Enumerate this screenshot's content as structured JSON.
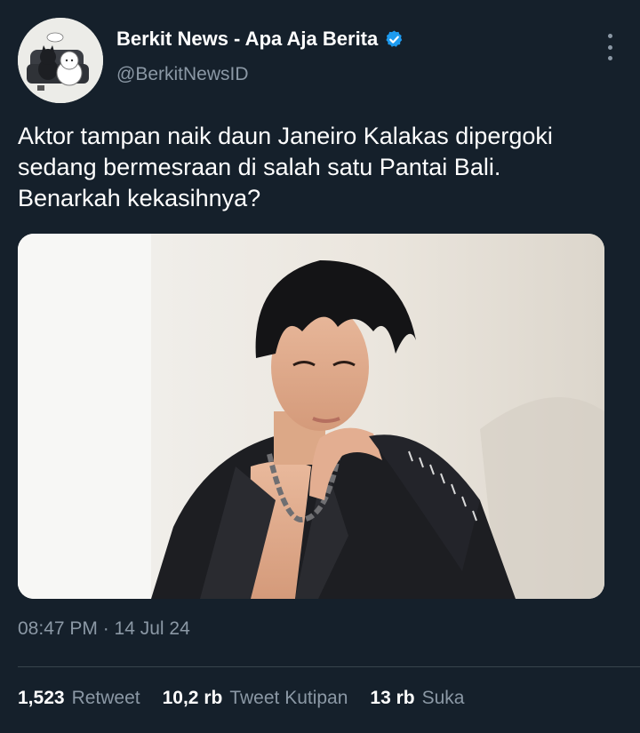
{
  "author": {
    "display_name": "Berkit News - Apa Aja Berita",
    "handle": "@BerkitNewsID",
    "verified": true,
    "avatar_icon": "cartoon-cats-avatar"
  },
  "tweet": {
    "text": "Aktor tampan naik daun Janeiro Kalakas dipergoki\nsedang bermesraan di salah satu Pantai Bali.\nBenarkah kekasihnya?",
    "timestamp": "08:47 PM · 14 Jul 24"
  },
  "stats": {
    "retweets": {
      "count": "1,523",
      "label": "Retweet"
    },
    "quote_tweets": {
      "count": "10,2 rb",
      "label": "Tweet Kutipan"
    },
    "likes": {
      "count": "13 rb",
      "label": "Suka"
    }
  },
  "icons": {
    "verified": "verified-badge-icon",
    "more": "more-options-icon"
  },
  "colors": {
    "background": "#15202b",
    "text_primary": "#ffffff",
    "text_secondary": "#8b98a5",
    "verified": "#1d9bf0",
    "divider": "#38444d"
  }
}
